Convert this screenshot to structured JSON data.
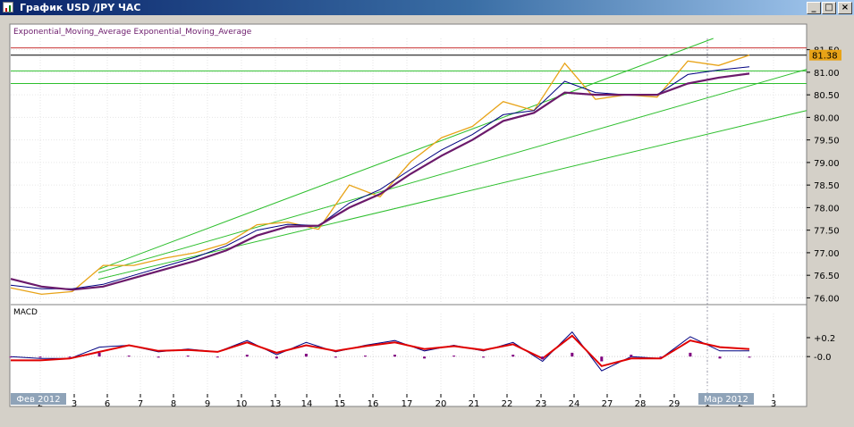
{
  "window": {
    "title": "График USD /JPY ЧАС",
    "buttons": {
      "minimize": "_",
      "maximize": "□",
      "close": "×"
    }
  },
  "colors": {
    "chart_bg": "#ffffff",
    "price": "#e8a317",
    "ema_fast": "#000080",
    "ema_slow": "#6b1a6b",
    "trendline": "#2ebf2e",
    "hline_red": "#c83232",
    "hline_black": "#000000",
    "macd_line": "#000080",
    "signal_line": "#e00000",
    "hist": "#800080",
    "price_tag_bg": "#e8a317"
  },
  "chart_data": [
    {
      "type": "line",
      "legend": "Exponential_Moving_Average Exponential_Moving_Average",
      "x_ticks": [
        "2",
        "3",
        "6",
        "7",
        "8",
        "9",
        "10",
        "13",
        "14",
        "15",
        "16",
        "17",
        "20",
        "21",
        "22",
        "23",
        "24",
        "27",
        "28",
        "29",
        "1",
        "2",
        "3"
      ],
      "x_period_labels": [
        {
          "label": "Фев 2012",
          "at_tick": 0
        },
        {
          "label": "Мар 2012",
          "at_tick": 20
        }
      ],
      "y_ticks": [
        "81.50",
        "81.00",
        "80.50",
        "80.00",
        "79.50",
        "79.00",
        "78.50",
        "78.00",
        "77.50",
        "77.00",
        "76.50",
        "76.00"
      ],
      "ylim": [
        75.85,
        81.75
      ],
      "current_price_label": "81.38",
      "series": [
        {
          "role": "price",
          "values": [
            76.22,
            76.08,
            76.14,
            76.72,
            76.72,
            76.88,
            77.0,
            77.2,
            77.62,
            77.68,
            77.52,
            78.5,
            78.24,
            79.02,
            79.55,
            79.8,
            80.35,
            80.15,
            81.2,
            80.4,
            80.5,
            80.45,
            81.25,
            81.15,
            81.38
          ]
        },
        {
          "role": "ema_fast",
          "values": [
            76.28,
            76.2,
            76.2,
            76.3,
            76.5,
            76.7,
            76.9,
            77.15,
            77.5,
            77.63,
            77.6,
            78.1,
            78.4,
            78.85,
            79.28,
            79.62,
            80.06,
            80.15,
            80.8,
            80.55,
            80.5,
            80.5,
            80.95,
            81.05,
            81.12
          ]
        },
        {
          "role": "ema_slow",
          "values": [
            76.42,
            76.25,
            76.18,
            76.25,
            76.44,
            76.63,
            76.82,
            77.05,
            77.38,
            77.58,
            77.6,
            78.0,
            78.3,
            78.75,
            79.15,
            79.5,
            79.92,
            80.1,
            80.55,
            80.5,
            80.5,
            80.5,
            80.75,
            80.88,
            80.97
          ]
        }
      ],
      "trendlines": [
        {
          "from": [
            0,
            76.0
          ],
          "to": [
            24,
            80.7
          ]
        },
        {
          "from": [
            0,
            75.95
          ],
          "to": [
            24,
            79.85
          ]
        },
        {
          "from": [
            0,
            75.9
          ],
          "to": [
            24,
            82.05
          ]
        }
      ],
      "hlines": [
        {
          "y": 81.54,
          "color": "red"
        },
        {
          "y": 81.38,
          "color": "black"
        },
        {
          "y": 81.03,
          "color": "green"
        },
        {
          "y": 80.75,
          "color": "green"
        }
      ]
    },
    {
      "type": "line",
      "title": "MACD",
      "y_ticks": [
        "+0.2",
        "-0.0"
      ],
      "ylim": [
        -0.3,
        0.36
      ],
      "series": [
        {
          "role": "macd",
          "values": [
            0.0,
            -0.02,
            -0.02,
            0.1,
            0.12,
            0.05,
            0.08,
            0.05,
            0.17,
            0.02,
            0.15,
            0.05,
            0.12,
            0.17,
            0.06,
            0.12,
            0.06,
            0.15,
            -0.05,
            0.26,
            -0.15,
            0.0,
            -0.02,
            0.21,
            0.06,
            0.06
          ]
        },
        {
          "role": "signal",
          "values": [
            -0.04,
            -0.04,
            -0.02,
            0.05,
            0.12,
            0.06,
            0.07,
            0.05,
            0.15,
            0.04,
            0.12,
            0.06,
            0.11,
            0.15,
            0.08,
            0.11,
            0.07,
            0.13,
            -0.02,
            0.22,
            -0.1,
            -0.02,
            -0.02,
            0.17,
            0.1,
            0.08
          ]
        },
        {
          "role": "histogram",
          "values": [
            0.0,
            -0.01,
            0.0,
            0.04,
            0.01,
            -0.01,
            0.01,
            0.0,
            0.02,
            -0.02,
            0.03,
            -0.01,
            0.01,
            0.02,
            -0.02,
            0.01,
            -0.01,
            0.02,
            -0.03,
            0.04,
            -0.05,
            0.02,
            0.0,
            0.04,
            -0.02,
            -0.01
          ]
        }
      ]
    }
  ]
}
